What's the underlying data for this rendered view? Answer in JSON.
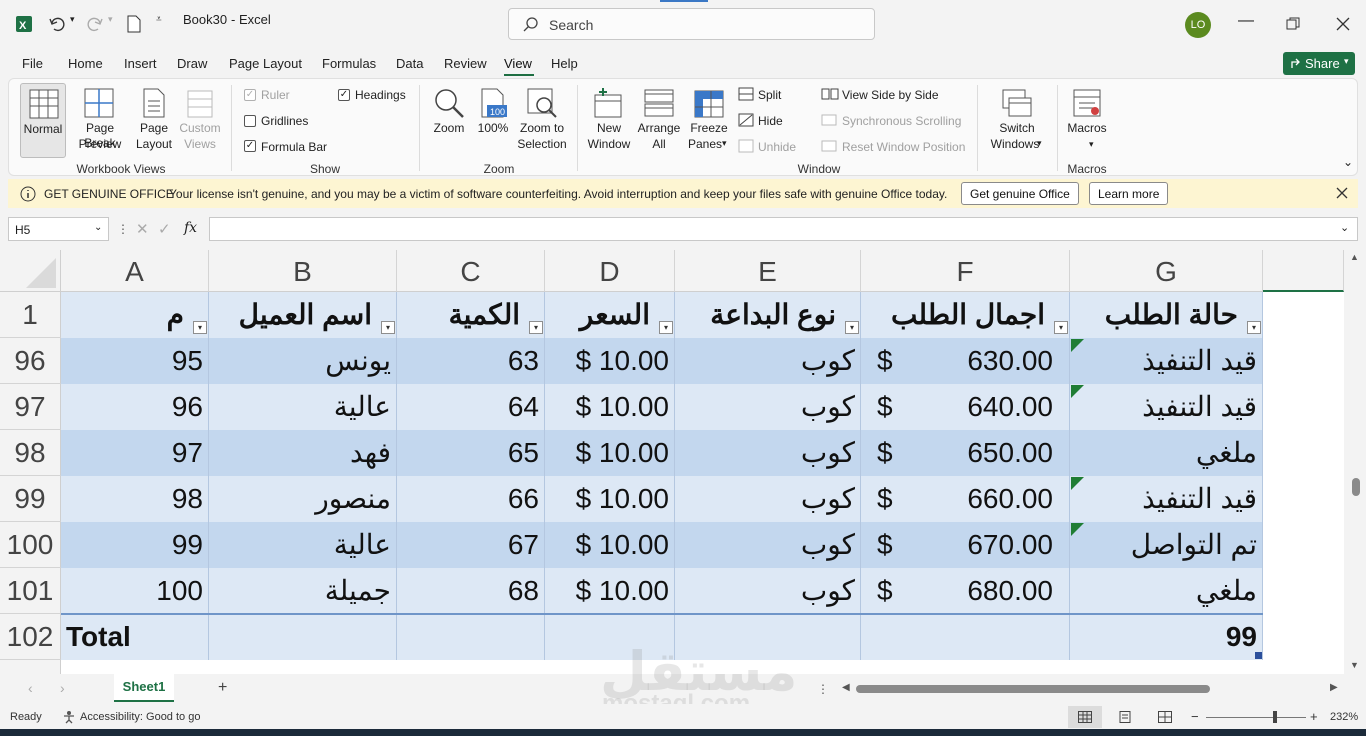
{
  "app": {
    "file_name": "Book30",
    "separator": "-",
    "app_name": "Excel",
    "search_placeholder": "Search",
    "user_initials": "LO",
    "share_label": "Share"
  },
  "menu": [
    "File",
    "Home",
    "Insert",
    "Draw",
    "Page Layout",
    "Formulas",
    "Data",
    "Review",
    "View",
    "Help"
  ],
  "ribbon": {
    "workbook_views": {
      "label": "Workbook Views",
      "normal": "Normal",
      "page_break_1": "Page Break",
      "page_break_2": "Preview",
      "page_layout_1": "Page",
      "page_layout_2": "Layout",
      "custom_1": "Custom",
      "custom_2": "Views"
    },
    "show": {
      "label": "Show",
      "ruler": "Ruler",
      "gridlines": "Gridlines",
      "formula_bar": "Formula Bar",
      "headings": "Headings"
    },
    "zoom": {
      "label": "Zoom",
      "zoom": "Zoom",
      "hundred": "100%",
      "zoom_sel_1": "Zoom to",
      "zoom_sel_2": "Selection",
      "icon_text": "100"
    },
    "window": {
      "label": "Window",
      "new_1": "New",
      "new_2": "Window",
      "arrange_1": "Arrange",
      "arrange_2": "All",
      "freeze_1": "Freeze",
      "freeze_2": "Panes",
      "split": "Split",
      "hide": "Hide",
      "unhide": "Unhide",
      "side_by_side": "View Side by Side",
      "sync_scroll": "Synchronous Scrolling",
      "reset_pos": "Reset Window Position",
      "switch_1": "Switch",
      "switch_2": "Windows"
    },
    "macros": {
      "label": "Macros",
      "macros": "Macros"
    }
  },
  "infobar": {
    "title": "GET GENUINE OFFICE",
    "message": "Your license isn't genuine, and you may be a victim of software counterfeiting. Avoid interruption and keep your files safe with genuine Office today.",
    "btn_genuine": "Get genuine Office",
    "btn_learn": "Learn more"
  },
  "formula_bar": {
    "name_box": "H5",
    "fx": "fx",
    "value": ""
  },
  "grid": {
    "columns": [
      "A",
      "B",
      "C",
      "D",
      "E",
      "F",
      "G"
    ],
    "header_row": {
      "row": "1",
      "cells": [
        "م",
        "اسم العميل",
        "الكمية",
        "السعر",
        "نوع البداعة",
        "اجمال الطلب",
        "حالة الطلب"
      ]
    },
    "rows": [
      {
        "row": "96",
        "a": "95",
        "b": "يونس",
        "c": "63",
        "d": "$ 10.00",
        "e": "كوب",
        "f_sym": "$",
        "f": "630.00",
        "g": "قيد التنفيذ",
        "flag": true
      },
      {
        "row": "97",
        "a": "96",
        "b": "عالية",
        "c": "64",
        "d": "$ 10.00",
        "e": "كوب",
        "f_sym": "$",
        "f": "640.00",
        "g": "قيد التنفيذ",
        "flag": true
      },
      {
        "row": "98",
        "a": "97",
        "b": "فهد",
        "c": "65",
        "d": "$ 10.00",
        "e": "كوب",
        "f_sym": "$",
        "f": "650.00",
        "g": "ملغي",
        "flag": false
      },
      {
        "row": "99",
        "a": "98",
        "b": "منصور",
        "c": "66",
        "d": "$ 10.00",
        "e": "كوب",
        "f_sym": "$",
        "f": "660.00",
        "g": "قيد التنفيذ",
        "flag": true
      },
      {
        "row": "100",
        "a": "99",
        "b": "عالية",
        "c": "67",
        "d": "$ 10.00",
        "e": "كوب",
        "f_sym": "$",
        "f": "670.00",
        "g": "تم التواصل",
        "flag": true
      },
      {
        "row": "101",
        "a": "100",
        "b": "جميلة",
        "c": "68",
        "d": "$ 10.00",
        "e": "كوب",
        "f_sym": "$",
        "f": "680.00",
        "g": "ملغي",
        "flag": false
      }
    ],
    "total_row": {
      "row": "102",
      "label": "Total",
      "value": "99"
    }
  },
  "sheet_tabs": {
    "active": "Sheet1",
    "add": "+"
  },
  "status": {
    "ready": "Ready",
    "accessibility": "Accessibility: Good to go",
    "zoom": "232%"
  },
  "watermark": {
    "arabic": "مستقل",
    "latin": "mostaql.com"
  },
  "colors": {
    "accent": "#1e7145",
    "band_dark": "#c3d7ee",
    "band_light": "#dde8f5",
    "flag": "#1f7d34"
  }
}
